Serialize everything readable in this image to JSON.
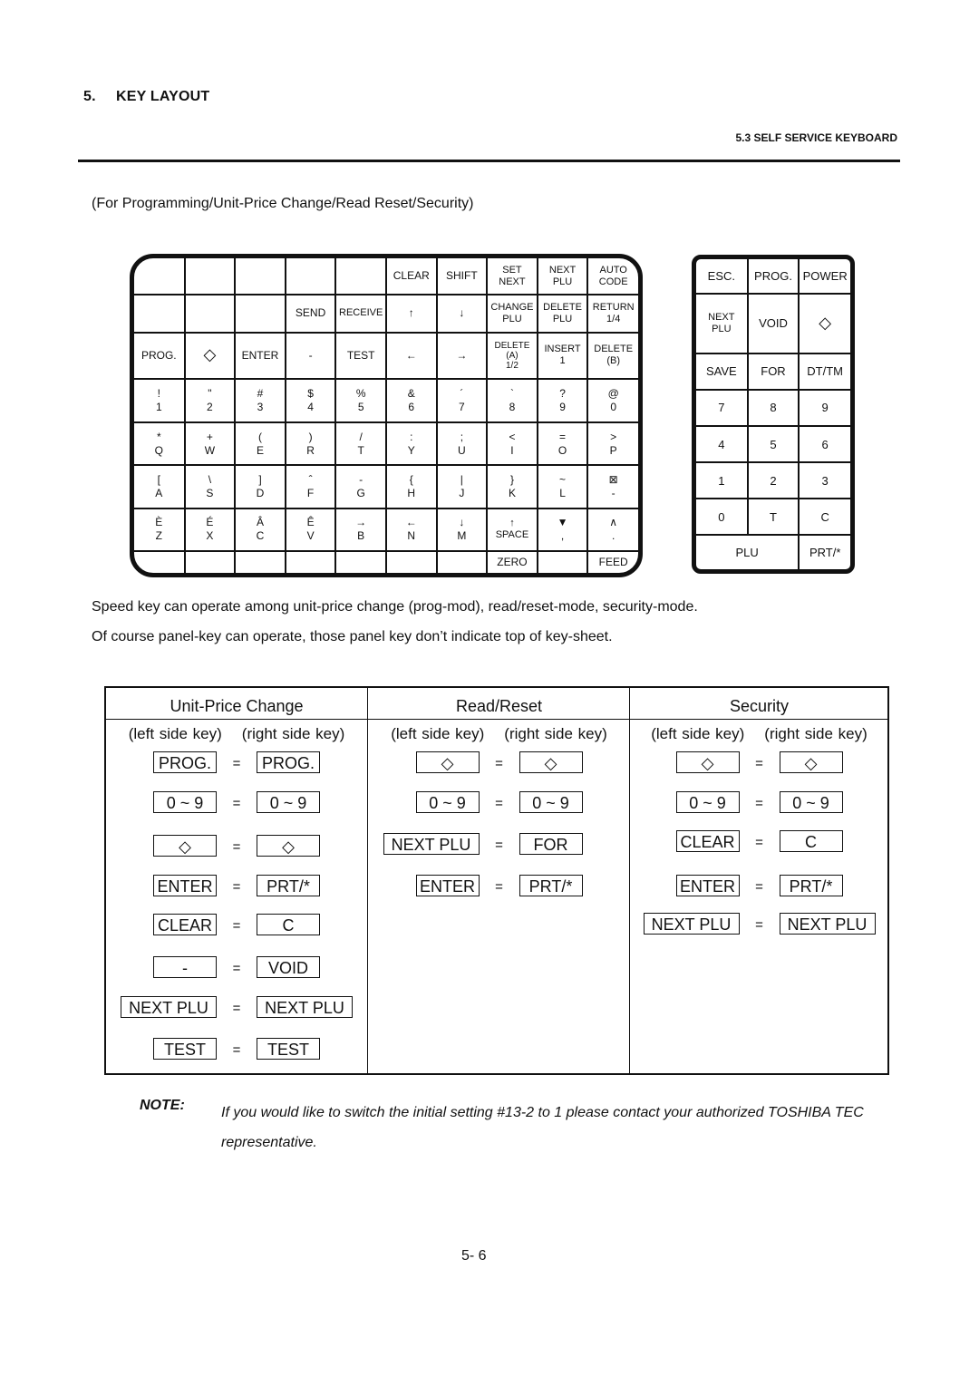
{
  "header": {
    "section_number": "5.",
    "section_title": "KEY LAYOUT",
    "subsection": "5.3 SELF SERVICE KEYBOARD"
  },
  "intro": "(For Programming/Unit-Price Change/Read Reset/Security)",
  "main_keyboard": {
    "rows": [
      [
        "",
        "",
        "",
        "",
        "",
        "CLEAR",
        "SHIFT",
        "SET\nNEXT",
        "NEXT\nPLU",
        "AUTO\nCODE"
      ],
      [
        "",
        "",
        "",
        "SEND",
        "RECEIVE",
        "↑",
        "↓",
        "CHANGE\nPLU",
        "DELETE\nPLU",
        "RETURN\n1/4"
      ],
      [
        "PROG.",
        "◇",
        "ENTER",
        "-",
        "TEST",
        "←",
        "→",
        "DELETE\n(A)\n1/2",
        "INSERT\n1",
        "DELETE\n(B)"
      ],
      [
        "!\n1",
        "\"\n2",
        "#\n3",
        "$\n4",
        "%\n5",
        "&\n6",
        "´\n7",
        "`\n8",
        "?\n9",
        "@\n0"
      ],
      [
        "*\nQ",
        "+\nW",
        "(\nE",
        ")\nR",
        "/\nT",
        ":\nY",
        ";\nU",
        "<\nI",
        "=\nO",
        ">\nP"
      ],
      [
        "[\nA",
        "\\\nS",
        "]\nD",
        "ˆ\nF",
        "-\nG",
        "{\nH",
        "|\nJ",
        "}\nK",
        "~\nL",
        "⊠\n-"
      ],
      [
        "È\nZ",
        "É\nX",
        "Â\nC",
        "Ê\nV",
        "→\nB",
        "←\nN",
        "↓\nM",
        "↑\nSPACE",
        "▼\n,",
        "∧\n."
      ],
      [
        "",
        "",
        "",
        "",
        "",
        "",
        "",
        "ZERO",
        "",
        "FEED"
      ]
    ]
  },
  "side_keyboard": {
    "rows": [
      [
        "ESC.",
        "PROG.",
        "POWER"
      ],
      [
        "NEXT\nPLU",
        "VOID",
        "◇"
      ],
      [
        "SAVE",
        "FOR",
        "DT/TM"
      ],
      [
        "7",
        "8",
        "9"
      ],
      [
        "4",
        "5",
        "6"
      ],
      [
        "1",
        "2",
        "3"
      ],
      [
        "0",
        "T",
        "C"
      ],
      [
        "PLU",
        "PRT/*"
      ]
    ]
  },
  "paragraphs": [
    "Speed key can operate among unit-price change (prog-mod), read/reset-mode, security-mode.",
    "Of course panel-key can operate, those panel key don’t indicate top of key-sheet."
  ],
  "mapping": {
    "left_label": "(left side key)",
    "right_label": "(right side key)",
    "equals": "=",
    "columns": [
      {
        "title": "Unit-Price Change",
        "pairs": [
          [
            "PROG.",
            "PROG."
          ],
          [
            "0 ~ 9",
            "0 ~ 9"
          ],
          [
            "◇",
            "◇"
          ],
          [
            "ENTER",
            "PRT/*"
          ],
          [
            "CLEAR",
            "C"
          ],
          [
            "-",
            "VOID"
          ],
          [
            "NEXT PLU",
            "NEXT PLU"
          ],
          [
            "TEST",
            "TEST"
          ]
        ]
      },
      {
        "title": "Read/Reset",
        "pairs": [
          [
            "◇",
            "◇"
          ],
          [
            "0 ~ 9",
            "0 ~ 9"
          ],
          [
            "NEXT PLU",
            "FOR"
          ],
          [
            "ENTER",
            "PRT/*"
          ]
        ]
      },
      {
        "title": "Security",
        "pairs": [
          [
            "◇",
            "◇"
          ],
          [
            "0 ~ 9",
            "0 ~ 9"
          ],
          [
            "CLEAR",
            "C"
          ],
          [
            "ENTER",
            "PRT/*"
          ],
          [
            "NEXT PLU",
            "NEXT PLU"
          ]
        ]
      }
    ]
  },
  "note": {
    "label": "NOTE:",
    "text": "If you would like to switch the initial setting #13-2 to 1 please contact your authorized TOSHIBA TEC representative."
  },
  "page_number": "5- 6"
}
